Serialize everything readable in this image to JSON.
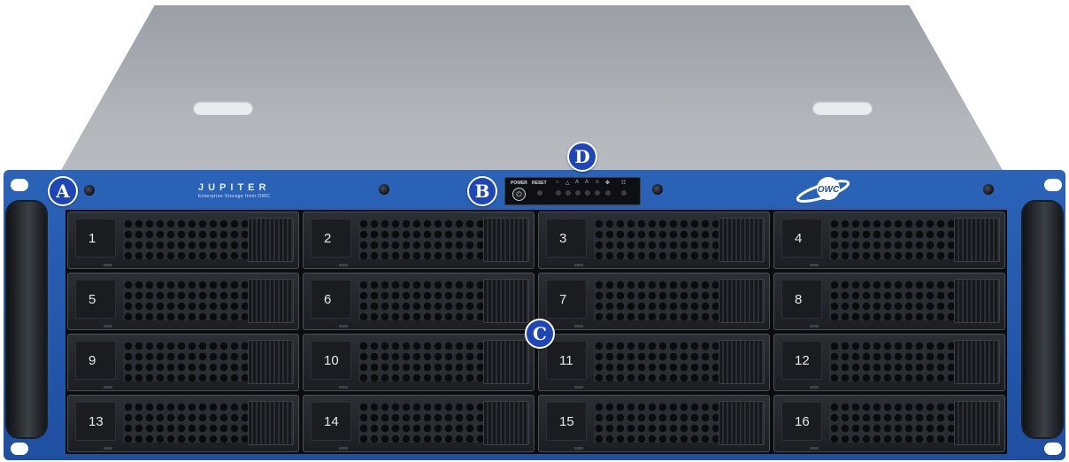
{
  "product": {
    "brand_name": "JUPITER",
    "tagline": "Enterprise Storage from OWC",
    "logo_text": "OWC"
  },
  "controls": {
    "power_label": "POWER",
    "reset_label": "RESET",
    "power_icon": "power-symbol"
  },
  "callouts": [
    "A",
    "B",
    "C",
    "D"
  ],
  "bays": [
    "1",
    "2",
    "3",
    "4",
    "5",
    "6",
    "7",
    "8",
    "9",
    "10",
    "11",
    "12",
    "13",
    "14",
    "15",
    "16"
  ]
}
